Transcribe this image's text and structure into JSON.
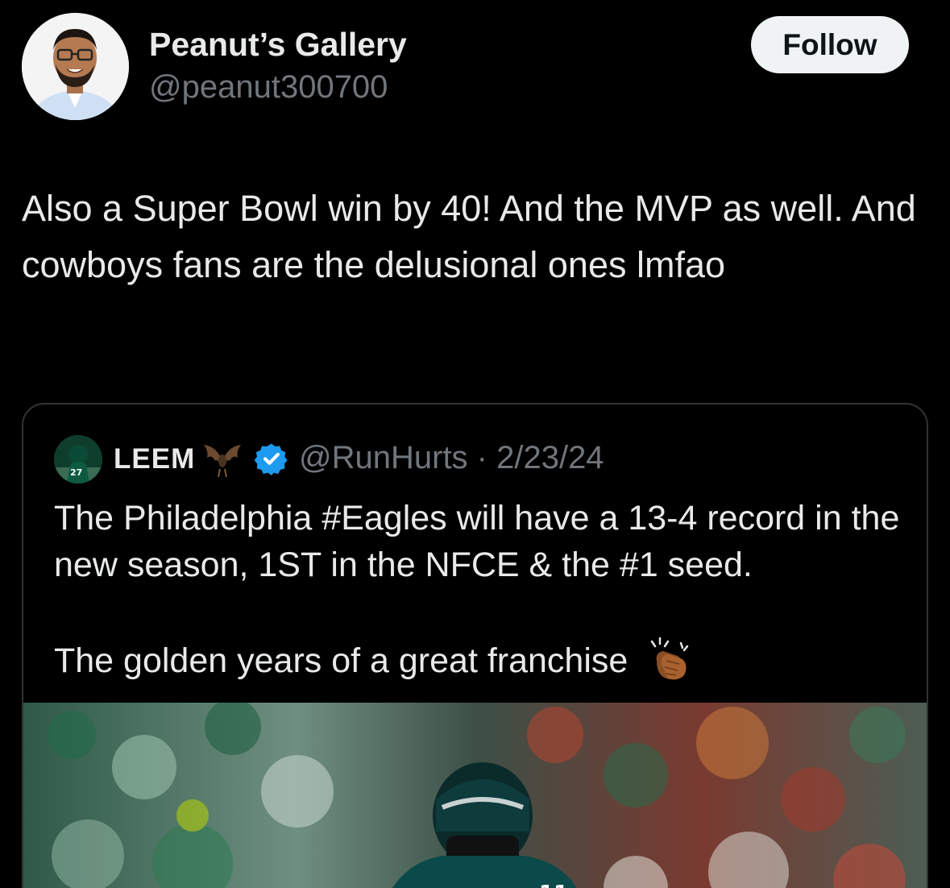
{
  "author": {
    "display_name": "Peanut’s Gallery",
    "handle": "@peanut300700",
    "avatar_icon": "profile-photo-icon"
  },
  "follow_label": "Follow",
  "tweet": {
    "text": "Also a Super Bowl win by 40! And the MVP as well. And cowboys fans are the delusional ones lmfao"
  },
  "quoted_tweet": {
    "display_name": "LEEM",
    "name_emoji": "bat-emoji-icon",
    "verified_icon": "verified-badge-icon",
    "handle_and_date": "@RunHurts · 2/23/24",
    "text": "The Philadelphia #Eagles will have a 13-4 record in the new season, 1ST in the NFCE & the #1 seed.",
    "text_line3": "The golden years of a great franchise",
    "trailing_emoji": "clapping-hands-emoji-icon",
    "media_icon": "football-player-photo-icon"
  },
  "colors": {
    "background": "#000000",
    "primary_text": "#e7e9ea",
    "secondary_text": "#71767b",
    "border": "#2f3336",
    "verified_blue": "#1d9bf0",
    "follow_bg": "#eff3f4"
  }
}
